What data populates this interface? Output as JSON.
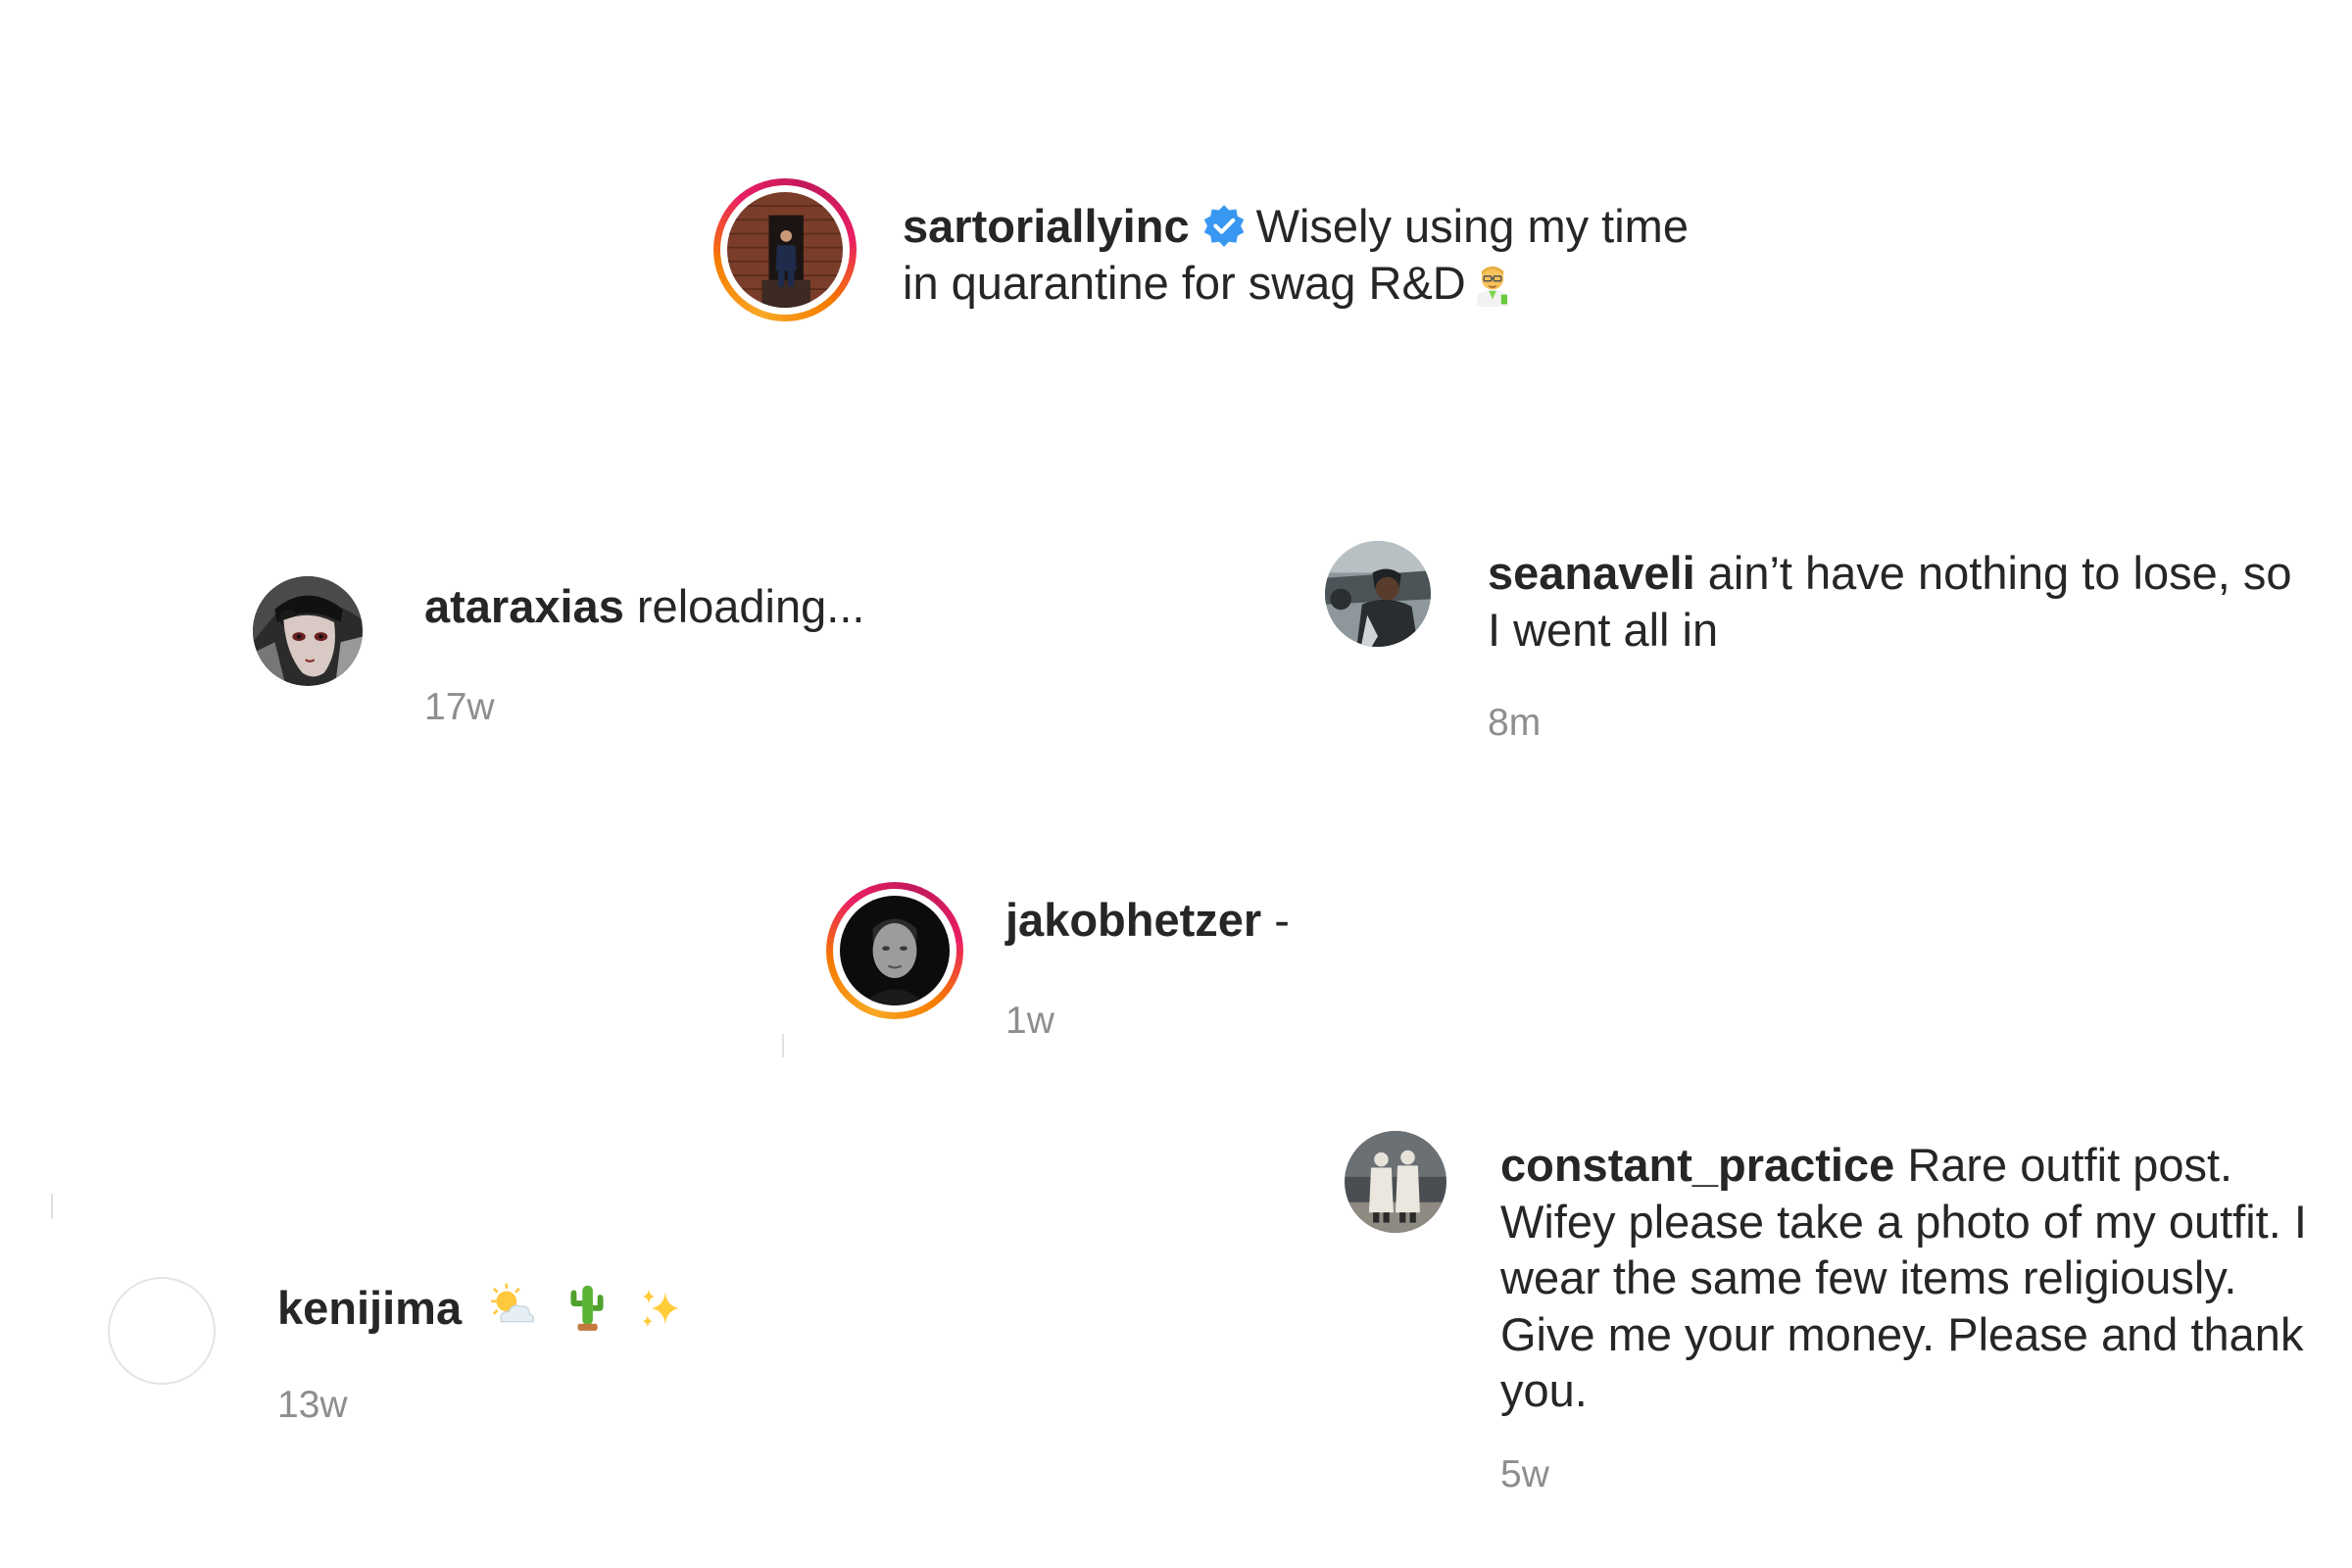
{
  "caption": {
    "username": "sartoriallyinc",
    "line1": "Wisely using my time",
    "line2": "in quarantine for swag R&D"
  },
  "comments": [
    {
      "username": "ataraxias",
      "text": "reloading...",
      "time": "17w"
    },
    {
      "username": "seanaveli",
      "text_line1": "ain’t have nothing to lose, so",
      "text_line2": "I went all in",
      "time": "8m"
    },
    {
      "username": "jakobhetzer",
      "text": "-",
      "time": "1w"
    },
    {
      "username": "constant_practice",
      "text_line1": "Rare outfit post.",
      "text_line2": "Wifey please take a photo of my outfit. I",
      "text_line3": "wear the same few items religiously.",
      "text_line4": "Give me your money. Please and thank",
      "text_line5": "you.",
      "time": "5w"
    },
    {
      "username": "kenijima",
      "time": "13w"
    }
  ],
  "icons": {
    "verified": "verified-badge-icon",
    "scientist": "man-scientist-emoji",
    "sun_cloud": "sun-behind-cloud-emoji",
    "cactus": "cactus-emoji",
    "sparkles": "sparkles-emoji"
  },
  "colors": {
    "text": "#262626",
    "muted": "#8e8e8e",
    "verified": "#3897f0",
    "story_ring_start": "#f9a825",
    "story_ring_end": "#e91e63"
  }
}
